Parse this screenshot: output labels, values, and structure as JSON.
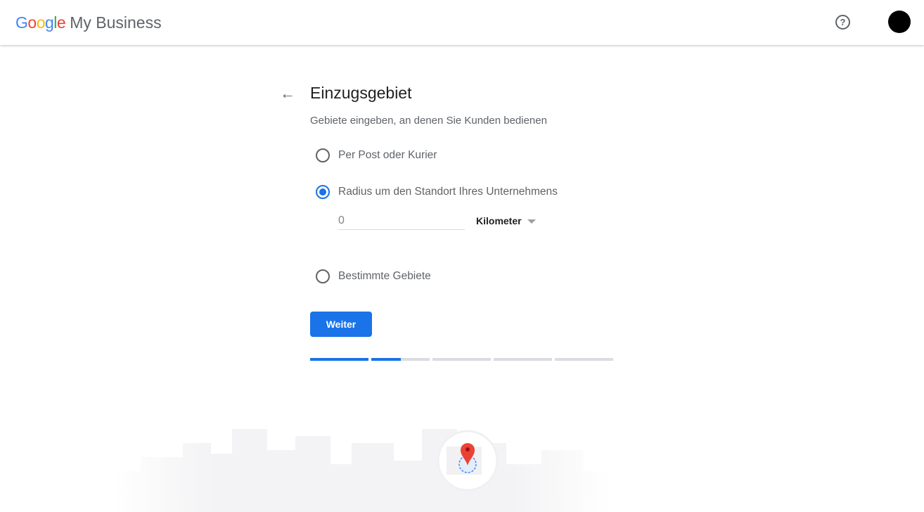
{
  "header": {
    "logo_text": "Google",
    "product": "My Business",
    "help_icon": "help-circle-icon",
    "avatar": "account-avatar"
  },
  "main": {
    "back_icon": "arrow-back-icon",
    "title": "Einzugsgebiet",
    "subtitle": "Gebiete eingeben, an denen Sie Kunden bedienen",
    "options": [
      {
        "label": "Per Post oder Kurier",
        "selected": false
      },
      {
        "label": "Radius um den Standort Ihres Unternehmens",
        "selected": true
      },
      {
        "label": "Bestimmte Gebiete",
        "selected": false
      }
    ],
    "radius_value": "0",
    "unit": "Kilometer",
    "next_button": "Weiter",
    "progress": {
      "segments": 5,
      "fills": [
        1,
        0.5,
        0,
        0,
        0
      ]
    },
    "accent": "#1a73e8"
  }
}
